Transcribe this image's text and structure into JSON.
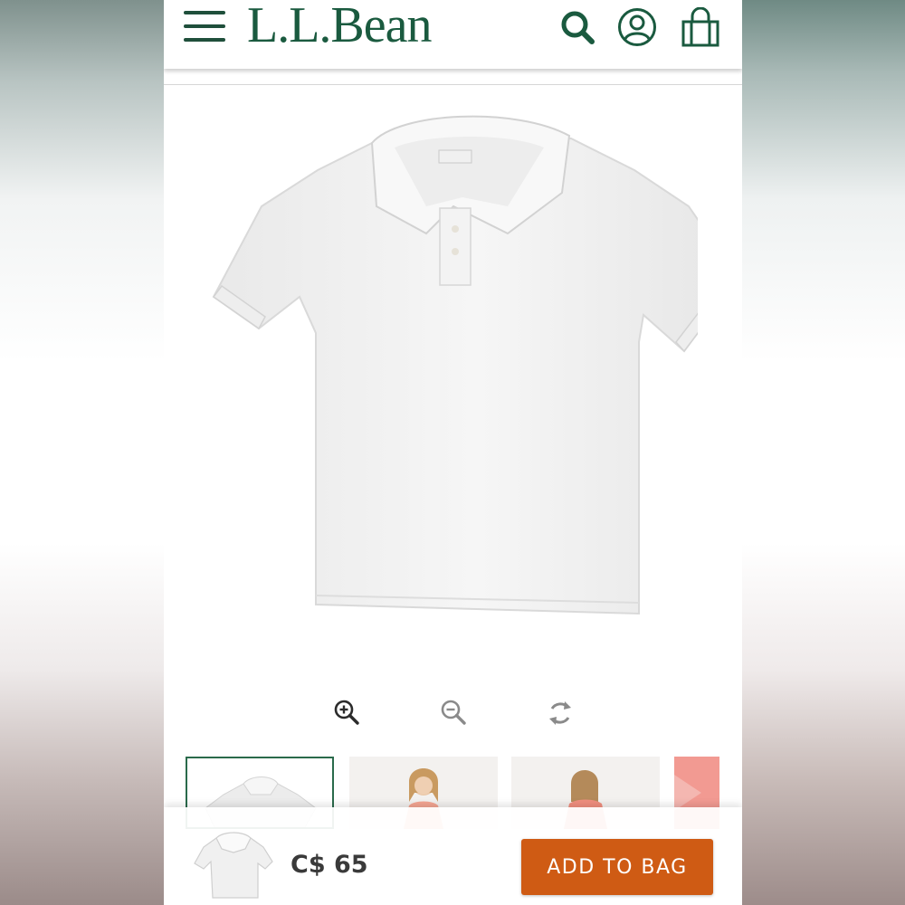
{
  "header": {
    "logo": "L.L.Bean",
    "menu_icon": "hamburger-menu-icon",
    "search_icon": "search-icon",
    "account_icon": "account-icon",
    "bag_icon": "shopping-bag-icon"
  },
  "product": {
    "image_icon": "white-polo-shirt-image",
    "color": "#ffffff"
  },
  "image_controls": {
    "zoom_in_icon": "zoom-in-icon",
    "zoom_out_icon": "zoom-out-icon",
    "reset_icon": "rotate-reset-icon"
  },
  "thumbnails": [
    {
      "icon": "white-polo-flat-thumbnail",
      "selected": true
    },
    {
      "icon": "model-front-thumbnail",
      "selected": false
    },
    {
      "icon": "model-back-thumbnail",
      "selected": false
    },
    {
      "icon": "coral-color-thumbnail",
      "selected": false
    }
  ],
  "purchase_bar": {
    "price": "C$ 65",
    "add_to_bag_label": "ADD TO BAG"
  },
  "colors": {
    "brand_green": "#1a5a3f",
    "button_orange": "#cf5b14",
    "price_text": "#3a3a3a"
  }
}
